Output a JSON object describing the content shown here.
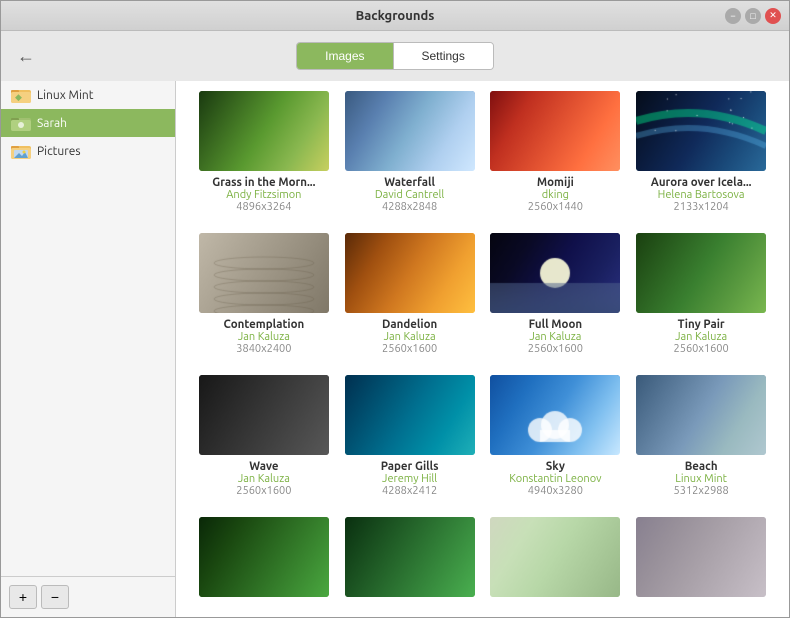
{
  "window": {
    "title": "Backgrounds",
    "controls": {
      "minimize": "−",
      "maximize": "□",
      "close": "✕"
    }
  },
  "toolbar": {
    "back_label": "←",
    "tabs": [
      {
        "id": "images",
        "label": "Images",
        "active": true
      },
      {
        "id": "settings",
        "label": "Settings",
        "active": false
      }
    ]
  },
  "sidebar": {
    "items": [
      {
        "id": "linux-mint",
        "label": "Linux Mint",
        "selected": false,
        "icon": "folder"
      },
      {
        "id": "sarah",
        "label": "Sarah",
        "selected": true,
        "icon": "folder-user"
      },
      {
        "id": "pictures",
        "label": "Pictures",
        "selected": false,
        "icon": "folder"
      }
    ],
    "add_label": "+",
    "remove_label": "−"
  },
  "images": [
    {
      "title": "Grass in the Morn...",
      "author": "Andy Fitzsimon",
      "size": "4896x3264",
      "thumb_class": "thumb-grass"
    },
    {
      "title": "Waterfall",
      "author": "David Cantrell",
      "size": "4288x2848",
      "thumb_class": "thumb-waterfall"
    },
    {
      "title": "Momiji",
      "author": "dking",
      "size": "2560x1440",
      "thumb_class": "thumb-momiji"
    },
    {
      "title": "Aurora over Icela...",
      "author": "Helena Bartosova",
      "size": "2133x1204",
      "thumb_class": "thumb-aurora"
    },
    {
      "title": "Contemplation",
      "author": "Jan Kaluza",
      "size": "3840x2400",
      "thumb_class": "thumb-contemplation"
    },
    {
      "title": "Dandelion",
      "author": "Jan Kaluza",
      "size": "2560x1600",
      "thumb_class": "thumb-dandelion"
    },
    {
      "title": "Full Moon",
      "author": "Jan Kaluza",
      "size": "2560x1600",
      "thumb_class": "thumb-fullmoon"
    },
    {
      "title": "Tiny Pair",
      "author": "Jan Kaluza",
      "size": "2560x1600",
      "thumb_class": "thumb-tinypair"
    },
    {
      "title": "Wave",
      "author": "Jan Kaluza",
      "size": "2560x1600",
      "thumb_class": "thumb-wave"
    },
    {
      "title": "Paper Gills",
      "author": "Jeremy Hill",
      "size": "4288x2412",
      "thumb_class": "thumb-papergills"
    },
    {
      "title": "Sky",
      "author": "Konstantin Leonov",
      "size": "4940x3280",
      "thumb_class": "thumb-sky"
    },
    {
      "title": "Beach",
      "author": "Linux Mint",
      "size": "5312x2988",
      "thumb_class": "thumb-beach"
    },
    {
      "title": "",
      "author": "",
      "size": "",
      "thumb_class": "thumb-leaf"
    },
    {
      "title": "",
      "author": "",
      "size": "",
      "thumb_class": "thumb-green2"
    },
    {
      "title": "",
      "author": "",
      "size": "",
      "thumb_class": "thumb-flowers"
    },
    {
      "title": "",
      "author": "",
      "size": "",
      "thumb_class": "thumb-gray"
    }
  ]
}
